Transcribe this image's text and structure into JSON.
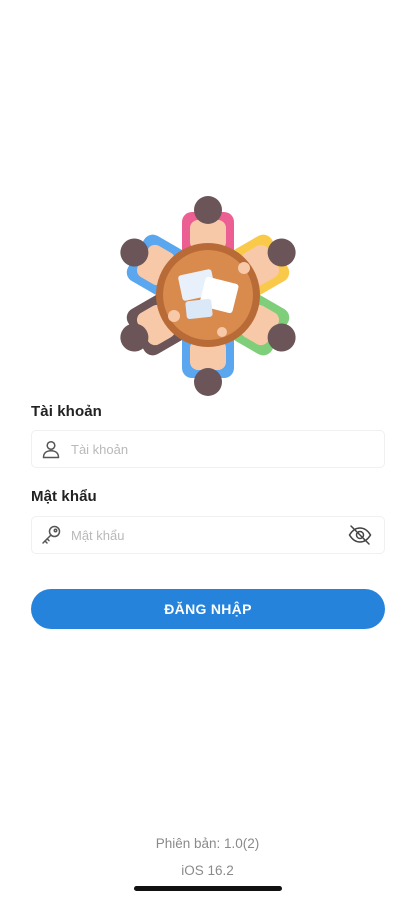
{
  "app": {
    "logo_icon": "team-meeting-round-table-icon"
  },
  "login_form": {
    "username": {
      "label": "Tài khoản",
      "placeholder": "Tài khoản",
      "value": "",
      "icon": "user-icon"
    },
    "password": {
      "label": "Mật khẩu",
      "placeholder": "Mật khẩu",
      "value": "",
      "icon": "key-icon",
      "toggle_icon": "eye-off-icon"
    },
    "submit_label": "ĐĂNG NHẬP"
  },
  "footer": {
    "app_version": "Phiên bản: 1.0(2)",
    "os_version": "iOS 16.2"
  },
  "colors": {
    "primary": "#2683db",
    "background": "#ffffff",
    "label": "#222222",
    "placeholder": "#b9b9b9",
    "footer_text": "#8a8a8a"
  }
}
